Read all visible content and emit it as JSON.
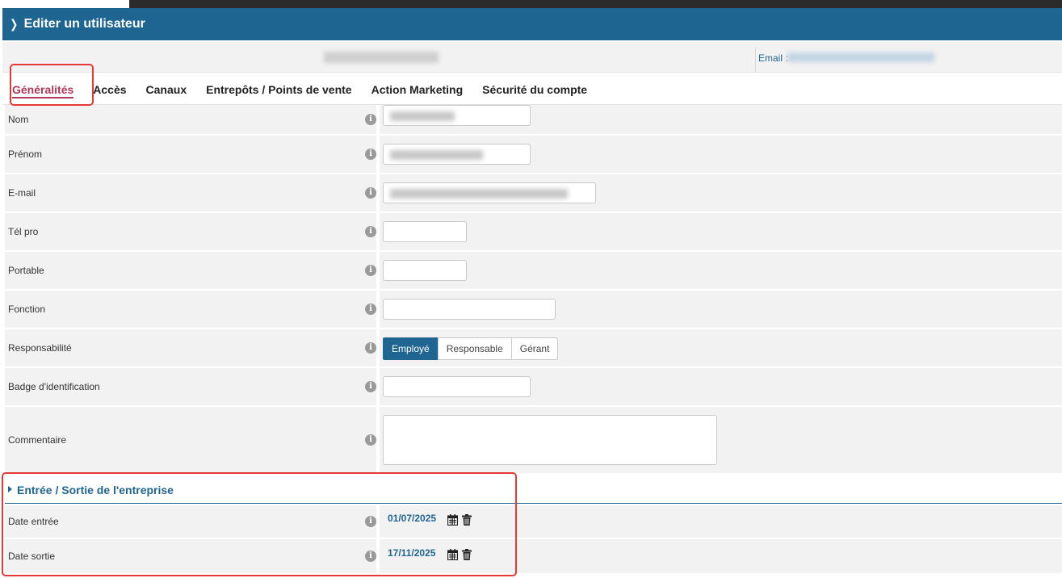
{
  "header": {
    "title": "Editer un utilisateur",
    "chevron": "chevron-right-icon"
  },
  "infobar": {
    "email_label": "Email :"
  },
  "tabs": [
    {
      "label": "Généralités",
      "active": true
    },
    {
      "label": "Accès",
      "active": false
    },
    {
      "label": "Canaux",
      "active": false
    },
    {
      "label": "Entrepôts / Points de vente",
      "active": false
    },
    {
      "label": "Action Marketing",
      "active": false
    },
    {
      "label": "Sécurité du compte",
      "active": false
    }
  ],
  "fields": {
    "nom": {
      "label": "Nom"
    },
    "prenom": {
      "label": "Prénom"
    },
    "email": {
      "label": "E-mail"
    },
    "tel_pro": {
      "label": "Tél pro",
      "value": ""
    },
    "portable": {
      "label": "Portable",
      "value": ""
    },
    "fonction": {
      "label": "Fonction",
      "value": ""
    },
    "responsabilite": {
      "label": "Responsabilité",
      "options": [
        "Employé",
        "Responsable",
        "Gérant"
      ],
      "selected": "Employé"
    },
    "badge": {
      "label": "Badge d'identification",
      "value": ""
    },
    "commentaire": {
      "label": "Commentaire",
      "value": ""
    }
  },
  "section": {
    "title": "Entrée / Sortie de l'entreprise",
    "date_entree": {
      "label": "Date entrée",
      "value": "01/07/2025"
    },
    "date_sortie": {
      "label": "Date sortie",
      "value": "17/11/2025"
    }
  },
  "colors": {
    "primary": "#1f6591",
    "active_tab": "#b03a5b",
    "highlight": "#e53935",
    "row_bg": "#f2f2f2"
  },
  "icons": {
    "info": "info-icon",
    "calendar": "calendar-icon",
    "trash": "trash-icon"
  }
}
